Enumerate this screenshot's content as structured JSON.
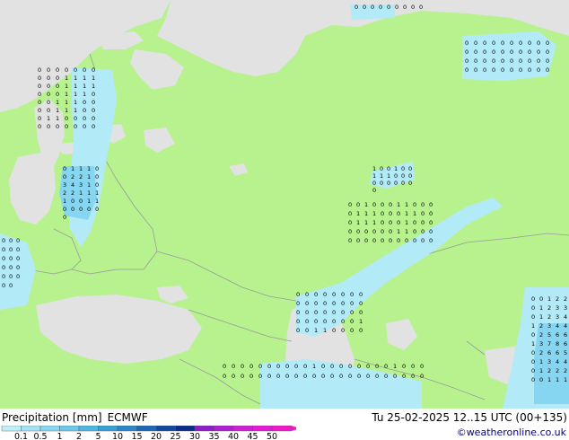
{
  "footer": {
    "title": "Precipitation [mm]",
    "model": "ECMWF",
    "valid_time": "Tu 25-02-2025 12..15 UTC (00+135)",
    "credit": "©weatheronline.co.uk"
  },
  "legend": {
    "labels": [
      "0.1",
      "0.5",
      "1",
      "2",
      "5",
      "10",
      "15",
      "20",
      "25",
      "30",
      "35",
      "40",
      "45",
      "50"
    ],
    "colors": [
      "#bfeff9",
      "#a3e3f5",
      "#87d6f1",
      "#6bc8ec",
      "#4fb6e4",
      "#3a9fd9",
      "#2a85cc",
      "#1c68b8",
      "#1149a0",
      "#0b2c87",
      "#8e1ec8",
      "#b11fd2",
      "#cf1fd6",
      "#e31bd6",
      "#f018c8"
    ]
  },
  "map": {
    "land_color": "#b7f28e",
    "sea_color": "#e2e2e2",
    "border_color": "#9a9a9a",
    "precip_color": "#b3eaf8",
    "clusters": [
      {
        "name": "barents-north",
        "values": [
          "0",
          "0",
          "0",
          "0",
          "0",
          "0",
          "0",
          "0",
          "0"
        ]
      },
      {
        "name": "kara-sea",
        "values": [
          "0",
          "0",
          "0",
          "0",
          "0",
          "0",
          "0",
          "0",
          "0",
          "0",
          "0",
          "0",
          "0",
          "0",
          "0",
          "0",
          "0",
          "0",
          "0",
          "0",
          "0",
          "0",
          "0",
          "0",
          "0",
          "0",
          "0",
          "0",
          "0",
          "0",
          "0",
          "0",
          "0",
          "0",
          "0",
          "0",
          "0",
          "0",
          "0",
          "0"
        ]
      },
      {
        "name": "scandinavia",
        "values": [
          "0",
          "0",
          "0",
          "0",
          "0",
          "0",
          "0",
          "0",
          "0",
          "0",
          "1",
          "1",
          "1",
          "1",
          "0",
          "0",
          "0",
          "1",
          "1",
          "1",
          "1",
          "0",
          "0",
          "0",
          "1",
          "1",
          "1",
          "0",
          "0",
          "0",
          "1",
          "1",
          "1",
          "0",
          "0",
          "0",
          "0",
          "1",
          "1",
          "1",
          "0",
          "0",
          "0",
          "1",
          "1",
          "0",
          "0",
          "0",
          "0",
          "0",
          "0",
          "0",
          "0",
          "0",
          "0",
          "0"
        ]
      },
      {
        "name": "baltic",
        "values": [
          "0",
          "1",
          "1",
          "1",
          "0",
          "0",
          "2",
          "2",
          "1",
          "0",
          "3",
          "4",
          "3",
          "1",
          "0",
          "2",
          "2",
          "1",
          "1",
          "1",
          "1",
          "0",
          "0",
          "1",
          "1",
          "0",
          "0",
          "0",
          "0",
          "0",
          "0"
        ]
      },
      {
        "name": "west-siberia",
        "values": [
          "1",
          "0",
          "0",
          "1",
          "0",
          "0",
          "1",
          "1",
          "1",
          "0",
          "0",
          "0",
          "0",
          "0",
          "0",
          "0",
          "0",
          "0",
          "0"
        ]
      },
      {
        "name": "kazakh-front",
        "values": [
          "0",
          "0",
          "1",
          "0",
          "0",
          "0",
          "1",
          "1",
          "0",
          "0",
          "0",
          "0",
          "1",
          "1",
          "1",
          "0",
          "0",
          "0",
          "1",
          "1",
          "0",
          "0",
          "0",
          "1",
          "1",
          "1",
          "0",
          "0",
          "0",
          "1",
          "0",
          "0",
          "0",
          "0",
          "0",
          "0",
          "0",
          "0",
          "0",
          "1",
          "1",
          "0",
          "0",
          "0",
          "0",
          "0",
          "0",
          "0",
          "0",
          "0",
          "0",
          "0",
          "0",
          "0",
          "0"
        ]
      },
      {
        "name": "caspian",
        "values": [
          "0",
          "0",
          "0",
          "0",
          "0",
          "0",
          "0",
          "0",
          "0",
          "0",
          "0",
          "0",
          "0",
          "0",
          "0",
          "0",
          "0",
          "0",
          "0",
          "0",
          "0",
          "0",
          "0",
          "0",
          "0",
          "0",
          "0",
          "0",
          "0",
          "0",
          "0",
          "1",
          "0",
          "0",
          "1",
          "1",
          "0",
          "0",
          "0",
          "0"
        ]
      },
      {
        "name": "south-strip",
        "values": [
          "0",
          "0",
          "0",
          "0",
          "0",
          "0",
          "0",
          "0",
          "0",
          "0",
          "1",
          "0",
          "0",
          "0",
          "0",
          "0",
          "0",
          "0",
          "0",
          "1",
          "0",
          "0",
          "0",
          "0",
          "0",
          "0",
          "0",
          "0",
          "0",
          "0",
          "0",
          "0",
          "0",
          "0",
          "0",
          "0",
          "0",
          "0",
          "0",
          "0",
          "0",
          "0",
          "0",
          "0",
          "0",
          "0"
        ]
      },
      {
        "name": "southeast",
        "values": [
          "0",
          "0",
          "1",
          "2",
          "2",
          "0",
          "1",
          "2",
          "3",
          "3",
          "0",
          "1",
          "2",
          "3",
          "4",
          "1",
          "2",
          "3",
          "4",
          "4",
          "0",
          "2",
          "5",
          "6",
          "6",
          "1",
          "3",
          "7",
          "8",
          "6",
          "0",
          "2",
          "6",
          "6",
          "5",
          "0",
          "1",
          "3",
          "4",
          "4",
          "0",
          "1",
          "2",
          "2",
          "2",
          "0",
          "0",
          "1",
          "1",
          "1"
        ]
      },
      {
        "name": "west-edge",
        "values": [
          "0",
          "0",
          "0",
          "0",
          "0",
          "0",
          "0",
          "0",
          "0",
          "0",
          "0",
          "0",
          "0",
          "0",
          "0",
          "0",
          "0"
        ]
      }
    ]
  }
}
